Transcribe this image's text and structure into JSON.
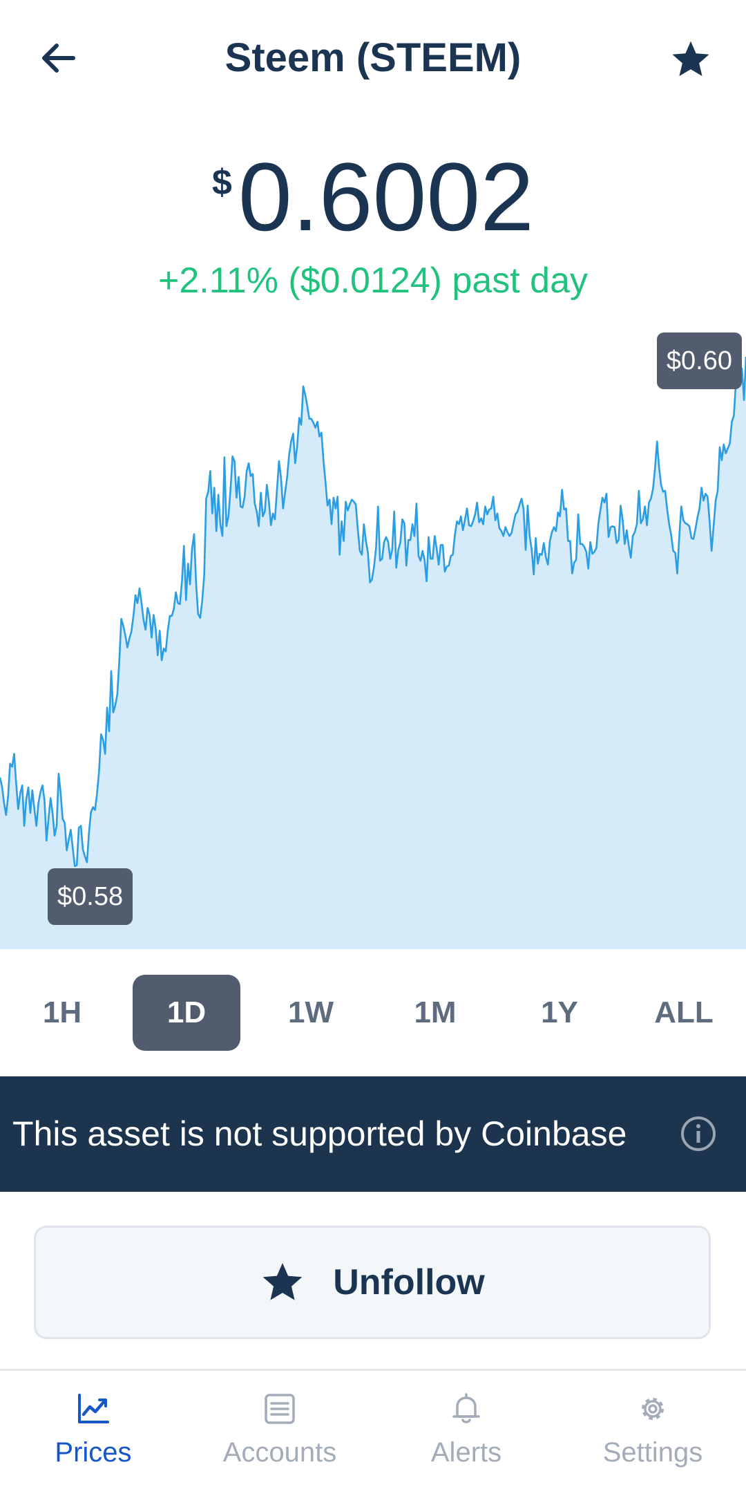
{
  "header": {
    "title": "Steem (STEEM)"
  },
  "price": {
    "currency_symbol": "$",
    "value": "0.6002",
    "change_text": "+2.11% ($0.0124) past day"
  },
  "chart_data": {
    "type": "area",
    "high_label": "$0.60",
    "low_label": "$0.58",
    "line_color": "#2b9de3",
    "fill_color": "#d5ebfa",
    "values": [
      0.5854,
      0.5845,
      0.5828,
      0.5816,
      0.5835,
      0.5868,
      0.5865,
      0.5878,
      0.5848,
      0.5822,
      0.5838,
      0.5846,
      0.5805,
      0.5832,
      0.5844,
      0.5818,
      0.5841,
      0.5822,
      0.5805,
      0.5828,
      0.5839,
      0.5846,
      0.5831,
      0.579,
      0.5812,
      0.5833,
      0.5818,
      0.5795,
      0.5805,
      0.5858,
      0.5838,
      0.5812,
      0.5808,
      0.578,
      0.5791,
      0.5801,
      0.5782,
      0.5764,
      0.5765,
      0.5803,
      0.5805,
      0.5781,
      0.5774,
      0.5768,
      0.5798,
      0.5819,
      0.5824,
      0.5821,
      0.5838,
      0.586,
      0.5898,
      0.5892,
      0.5878,
      0.5925,
      0.5901,
      0.5962,
      0.592,
      0.5927,
      0.5938,
      0.5972,
      0.6015,
      0.6008,
      0.5998,
      0.5986,
      0.5995,
      0.6002,
      0.6018,
      0.6039,
      0.6031,
      0.6046,
      0.6031,
      0.6014,
      0.6004,
      0.6026,
      0.6019,
      0.5996,
      0.6019,
      0.6005,
      0.5978,
      0.6003,
      0.5973,
      0.5985,
      0.5982,
      0.6003,
      0.6018,
      0.6018,
      0.6025,
      0.6042,
      0.6031,
      0.603,
      0.6053,
      0.6089,
      0.6034,
      0.6071,
      0.605,
      0.6086,
      0.6101,
      0.6051,
      0.602,
      0.6016,
      0.6033,
      0.6059,
      0.6137,
      0.6144,
      0.6165,
      0.6122,
      0.6148,
      0.6104,
      0.6141,
      0.6111,
      0.6099,
      0.6179,
      0.6109,
      0.6119,
      0.6146,
      0.618,
      0.6175,
      0.6138,
      0.6159,
      0.6129,
      0.6128,
      0.6139,
      0.6165,
      0.6173,
      0.616,
      0.6162,
      0.6132,
      0.6124,
      0.6109,
      0.6143,
      0.6119,
      0.6124,
      0.6151,
      0.6134,
      0.611,
      0.6122,
      0.6116,
      0.6146,
      0.6175,
      0.6158,
      0.6127,
      0.6143,
      0.6158,
      0.6181,
      0.6195,
      0.6203,
      0.6173,
      0.619,
      0.6219,
      0.6212,
      0.6251,
      0.6242,
      0.6231,
      0.6218,
      0.6218,
      0.6214,
      0.6209,
      0.6215,
      0.62,
      0.6204,
      0.6176,
      0.6154,
      0.613,
      0.6136,
      0.6111,
      0.6138,
      0.6127,
      0.6139,
      0.608,
      0.6114,
      0.6094,
      0.6134,
      0.6125,
      0.6131,
      0.6136,
      0.6134,
      0.6131,
      0.6106,
      0.6084,
      0.608,
      0.6111,
      0.6094,
      0.6082,
      0.6052,
      0.6055,
      0.6068,
      0.6087,
      0.6129,
      0.6074,
      0.6076,
      0.6093,
      0.6098,
      0.6093,
      0.6076,
      0.6085,
      0.6124,
      0.6067,
      0.6085,
      0.6092,
      0.6116,
      0.6112,
      0.6069,
      0.6095,
      0.6095,
      0.6111,
      0.6099,
      0.6132,
      0.6079,
      0.6074,
      0.6084,
      0.6075,
      0.6053,
      0.6098,
      0.6076,
      0.6076,
      0.6099,
      0.6086,
      0.607,
      0.609,
      0.609,
      0.6063,
      0.6068,
      0.6069,
      0.6079,
      0.608,
      0.61,
      0.6114,
      0.6111,
      0.6119,
      0.6105,
      0.6116,
      0.6127,
      0.611,
      0.6109,
      0.6114,
      0.6121,
      0.6133,
      0.6113,
      0.6117,
      0.6111,
      0.6129,
      0.6121,
      0.6126,
      0.6127,
      0.6139,
      0.6115,
      0.6122,
      0.6107,
      0.6104,
      0.6099,
      0.6108,
      0.6103,
      0.6099,
      0.6102,
      0.6112,
      0.6121,
      0.6124,
      0.6131,
      0.6137,
      0.6126,
      0.6085,
      0.613,
      0.6099,
      0.6085,
      0.606,
      0.6097,
      0.6071,
      0.6081,
      0.608,
      0.6092,
      0.6078,
      0.607,
      0.6094,
      0.6103,
      0.6108,
      0.6104,
      0.6123,
      0.6119,
      0.6146,
      0.6126,
      0.6127,
      0.6094,
      0.6094,
      0.6061,
      0.6072,
      0.6075,
      0.6121,
      0.6091,
      0.6091,
      0.6088,
      0.6083,
      0.6066,
      0.6093,
      0.6081,
      0.6083,
      0.6087,
      0.6112,
      0.6126,
      0.6138,
      0.6133,
      0.6142,
      0.6098,
      0.6108,
      0.6109,
      0.6108,
      0.6092,
      0.6095,
      0.613,
      0.6115,
      0.6091,
      0.6105,
      0.609,
      0.6077,
      0.6099,
      0.6103,
      0.6111,
      0.6145,
      0.6112,
      0.6116,
      0.6129,
      0.611,
      0.6133,
      0.6137,
      0.6147,
      0.6168,
      0.6195,
      0.6169,
      0.6151,
      0.6144,
      0.6145,
      0.6126,
      0.6111,
      0.61,
      0.6084,
      0.6082,
      0.6061,
      0.6099,
      0.6129,
      0.6115,
      0.6112,
      0.6111,
      0.6109,
      0.6097,
      0.6096,
      0.6106,
      0.6118,
      0.6127,
      0.6148,
      0.6135,
      0.6142,
      0.6139,
      0.6114,
      0.6084,
      0.611,
      0.6135,
      0.6145,
      0.6189,
      0.6176,
      0.6192,
      0.6183,
      0.6188,
      0.6193,
      0.6215,
      0.6221,
      0.6255,
      0.6272,
      0.6257,
      0.6269,
      0.6237,
      0.6281
    ]
  },
  "ranges": [
    {
      "label": "1H"
    },
    {
      "label": "1D",
      "active": true
    },
    {
      "label": "1W"
    },
    {
      "label": "1M"
    },
    {
      "label": "1Y"
    },
    {
      "label": "ALL"
    }
  ],
  "banner": {
    "text": "This asset is not supported by Coinbase"
  },
  "unfollow": {
    "label": "Unfollow"
  },
  "nav": [
    {
      "label": "Prices",
      "icon": "prices-chart-icon",
      "active": true
    },
    {
      "label": "Accounts",
      "icon": "accounts-list-icon"
    },
    {
      "label": "Alerts",
      "icon": "bell-icon"
    },
    {
      "label": "Settings",
      "icon": "gear-icon"
    }
  ],
  "colors": {
    "text_primary": "#1b3451",
    "positive": "#21c27e",
    "banner_bg": "#1d344f",
    "active_range": "#515c6e",
    "nav_active": "#1656c6",
    "nav_inactive": "#a3acb8"
  }
}
